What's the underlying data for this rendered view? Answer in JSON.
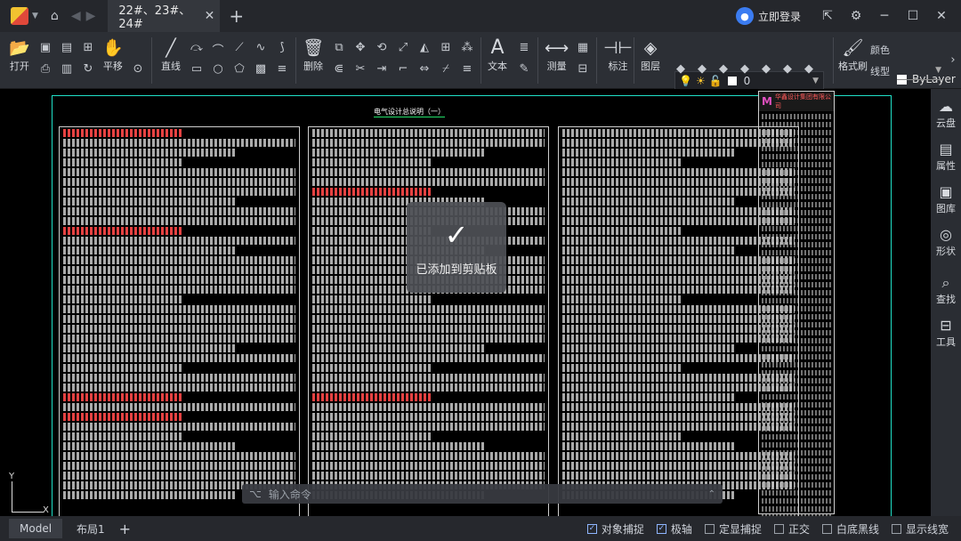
{
  "tab": {
    "title": "22#、23#、24#",
    "close": "✕"
  },
  "user": {
    "login": "立即登录"
  },
  "ribbon": {
    "open": "打开",
    "pan": "平移",
    "line": "直线",
    "delete": "删除",
    "text": "文本",
    "measure": "测量",
    "dimension": "标注",
    "layer": "图层",
    "format_brush": "格式刷",
    "color": "颜色",
    "linetype": "线型",
    "layer_value": "0",
    "bylayer": "ByLayer"
  },
  "drawing": {
    "title": "电气设计总说明（一）",
    "company": "华鑫设计集团有限公司"
  },
  "axis": {
    "y": "Y",
    "x": "X"
  },
  "toast": {
    "message": "已添加到剪贴板"
  },
  "command": {
    "placeholder": "输入命令"
  },
  "right_panel": [
    "云盘",
    "属性",
    "图库",
    "形状",
    "查找",
    "工具"
  ],
  "status": {
    "model": "Model",
    "layout1": "布局1",
    "toggles": [
      {
        "label": "对象捕捉",
        "checked": true
      },
      {
        "label": "极轴",
        "checked": true
      },
      {
        "label": "定显捕捉",
        "checked": false
      },
      {
        "label": "正交",
        "checked": false
      },
      {
        "label": "白底黑线",
        "checked": false
      },
      {
        "label": "显示线宽",
        "checked": false
      }
    ]
  }
}
